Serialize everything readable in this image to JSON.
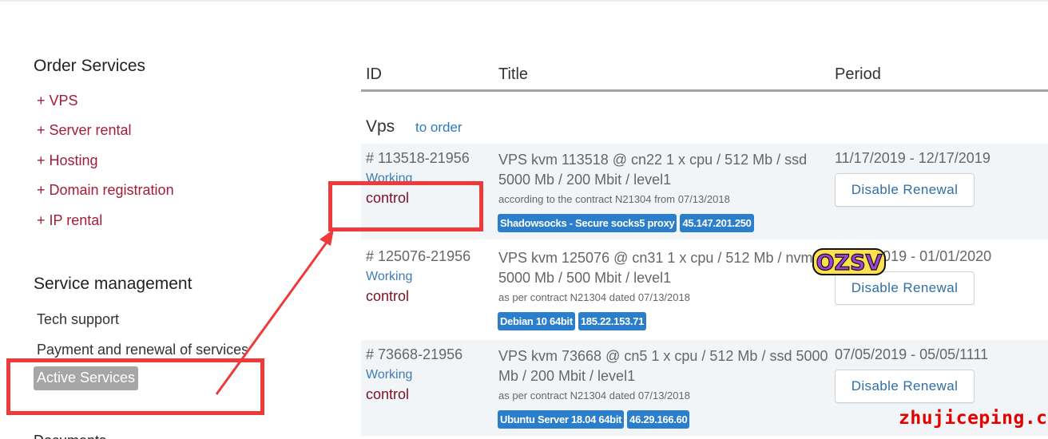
{
  "sidebar": {
    "order_title": "Order Services",
    "order_items": [
      "+ VPS",
      "+ Server rental",
      "+ Hosting",
      "+ Domain registration",
      "+ IP rental"
    ],
    "mgmt_title": "Service management",
    "mgmt_items": [
      "Tech support",
      "Payment and renewal of services"
    ],
    "mgmt_active": "Active Services",
    "next_section_partial": "Documents"
  },
  "table": {
    "headers": {
      "id": "ID",
      "title": "Title",
      "period": "Period"
    },
    "group": {
      "title": "Vps",
      "order_link": "to order"
    },
    "rows": [
      {
        "id": "# 113518-21956",
        "status": "Working",
        "control": "control",
        "title": "VPS kvm 113518 @ cn22 1 x cpu / 512 Mb / ssd 5000 Mb / 200 Mbit / level1",
        "contract": "according to the contract N21304 from 07/13/2018",
        "badges": [
          "Shadowsocks - Secure socks5 proxy",
          "45.147.201.250"
        ],
        "period": "11/17/2019 - 12/17/2019",
        "button": "Disable Renewal"
      },
      {
        "id": "# 125076-21956",
        "status": "Working",
        "control": "control",
        "title": "VPS kvm 125076 @ cn31 1 x cpu / 512 Mb / nvme 5000 Mb / 500 Mbit / level1",
        "contract": "as per contract N21304 dated 07/13/2018",
        "badges": [
          "Debian 10 64bit",
          "185.22.153.71"
        ],
        "period": "12/01/2019 - 01/01/2020",
        "button": "Disable Renewal"
      },
      {
        "id": "# 73668-21956",
        "status": "Working",
        "control": "control",
        "title": "VPS kvm 73668 @ cn5 1 x cpu / 512 Mb / ssd 5000 Mb / 200 Mbit / level1",
        "contract": "as per contract N21304 dated 07/13/2018",
        "badges": [
          "Ubuntu Server 18.04 64bit",
          "46.29.166.60"
        ],
        "period": "07/05/2019 - 05/05/1111",
        "button": "Disable Renewal"
      }
    ]
  },
  "overlays": {
    "stamp_text": "OZSV",
    "watermark": "zhujiceping.com",
    "highlight_color": "#ee3a3a"
  },
  "colors": {
    "order_link": "#a41c3a",
    "status_link": "#3f7cb4",
    "control_link": "#7a1027",
    "badge_bg": "#2a7ecb",
    "active_item_bg": "#a6a6a6"
  }
}
